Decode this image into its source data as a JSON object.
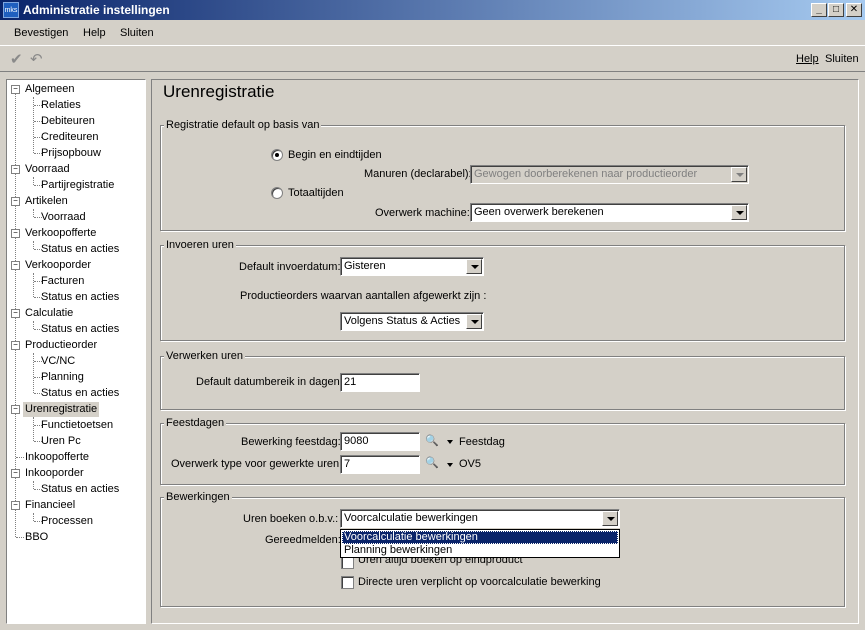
{
  "window": {
    "title": "Administratie instellingen",
    "app_icon_text": "mks"
  },
  "menu": [
    "Bevestigen",
    "Help",
    "Sluiten"
  ],
  "toolbar": {
    "help": "Help",
    "close": "Sluiten"
  },
  "tree": {
    "selected": "Urenregistratie",
    "nodes": [
      {
        "label": "Algemeen",
        "children": [
          "Relaties",
          "Debiteuren",
          "Crediteuren",
          "Prijsopbouw"
        ]
      },
      {
        "label": "Voorraad",
        "children": [
          "Partijregistratie"
        ]
      },
      {
        "label": "Artikelen",
        "children": [
          "Voorraad"
        ]
      },
      {
        "label": "Verkoopofferte",
        "children": [
          "Status en acties"
        ]
      },
      {
        "label": "Verkooporder",
        "children": [
          "Facturen",
          "Status en acties"
        ]
      },
      {
        "label": "Calculatie",
        "children": [
          "Status en acties"
        ]
      },
      {
        "label": "Productieorder",
        "children": [
          "VC/NC",
          "Planning",
          "Status en acties"
        ]
      },
      {
        "label": "Urenregistratie",
        "children": [
          "Functietoetsen",
          "Uren Pc"
        ]
      },
      {
        "label": "Inkoopofferte",
        "children": []
      },
      {
        "label": "Inkooporder",
        "children": [
          "Status en acties"
        ]
      },
      {
        "label": "Financieel",
        "children": [
          "Processen"
        ]
      },
      {
        "label": "BBO",
        "children": []
      }
    ]
  },
  "page": {
    "title": "Urenregistratie",
    "registratie": {
      "group": "Registratie default op basis van",
      "radio_begin": "Begin en eindtijden",
      "radio_totaal": "Totaaltijden",
      "manuren_label": "Manuren (declarabel):",
      "manuren_value": "Gewogen doorberekenen naar productieorder",
      "overwerk_label": "Overwerk machine:",
      "overwerk_value": "Geen overwerk berekenen"
    },
    "invoeren": {
      "group": "Invoeren uren",
      "datum_label": "Default invoerdatum:",
      "datum_value": "Gisteren",
      "po_label": "Productieorders waarvan aantallen afgewerkt zijn :",
      "po_value": "Volgens Status & Acties"
    },
    "verwerken": {
      "group": "Verwerken uren",
      "bereik_label": "Default datumbereik in dagen:",
      "bereik_value": "21"
    },
    "feestdagen": {
      "group": "Feestdagen",
      "bewerking_label": "Bewerking feestdag:",
      "bewerking_value": "9080",
      "bewerking_desc": "Feestdag",
      "overwerk_label": "Overwerk type voor gewerkte uren:",
      "overwerk_value": "7",
      "overwerk_desc": "OV5"
    },
    "bewerkingen": {
      "group": "Bewerkingen",
      "boeken_label": "Uren boeken o.b.v.:",
      "boeken_value": "Voorcalculatie bewerkingen",
      "gereed_label": "Gereedmelden:",
      "options": [
        "Voorcalculatie bewerkingen",
        "Planning bewerkingen"
      ],
      "check1": "Uren altijd boeken op eindproduct",
      "check2": "Directe uren verplicht op voorcalculatie bewerking"
    }
  }
}
